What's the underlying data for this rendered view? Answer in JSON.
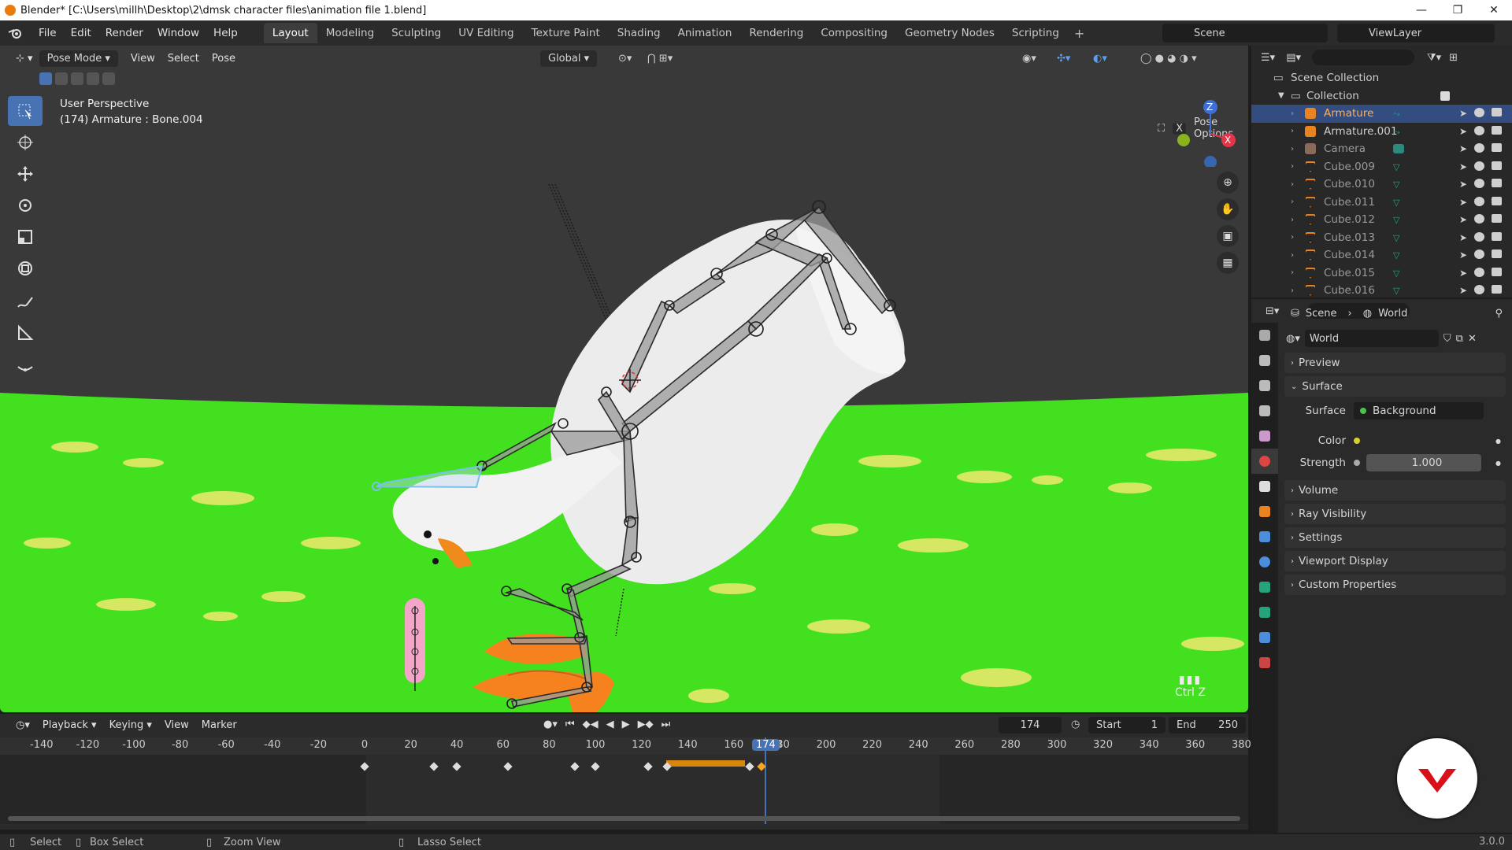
{
  "window": {
    "title": "Blender* [C:\\Users\\millh\\Desktop\\2\\dmsk character files\\animation file 1.blend]",
    "controls": [
      "—",
      "❐",
      "✕"
    ]
  },
  "menu": {
    "items": [
      "File",
      "Edit",
      "Render",
      "Window",
      "Help"
    ]
  },
  "workspaces": [
    "Layout",
    "Modeling",
    "Sculpting",
    "UV Editing",
    "Texture Paint",
    "Shading",
    "Animation",
    "Rendering",
    "Compositing",
    "Geometry Nodes",
    "Scripting"
  ],
  "active_workspace": "Layout",
  "scene_name": "Scene",
  "view_layer": "ViewLayer",
  "viewport": {
    "mode": "Pose Mode",
    "menus": [
      "View",
      "Select",
      "Pose"
    ],
    "orientation": "Global",
    "info_line1": "User Perspective",
    "info_line2": "(174) Armature : Bone.004",
    "pose_options": "Pose Options",
    "pose_x": "X",
    "ctrl_z": "Ctrl Z",
    "gizmo": {
      "z": "Z",
      "x": "X"
    }
  },
  "timeline": {
    "menus": [
      "Playback",
      "Keying",
      "View",
      "Marker"
    ],
    "current_frame": "174",
    "start_label": "Start",
    "start": "1",
    "end_label": "End",
    "end": "250",
    "ticks": [
      "-140",
      "-120",
      "-100",
      "-80",
      "-60",
      "-40",
      "-20",
      "0",
      "20",
      "40",
      "60",
      "80",
      "100",
      "120",
      "140",
      "160",
      "174",
      "180",
      "200",
      "220",
      "240",
      "260",
      "280",
      "300",
      "320",
      "340",
      "360",
      "380"
    ],
    "playhead": "174",
    "playhead_tail": "80",
    "keyframes": [
      0,
      30,
      40,
      62,
      91,
      100,
      123,
      131,
      167,
      172
    ]
  },
  "outliner": {
    "root": "Scene Collection",
    "collection": "Collection",
    "items": [
      {
        "name": "Armature",
        "selected": true
      },
      {
        "name": "Armature.001",
        "selected": false
      },
      {
        "name": "Camera",
        "selected": false
      },
      {
        "name": "Cube.009",
        "selected": false
      },
      {
        "name": "Cube.010",
        "selected": false
      },
      {
        "name": "Cube.011",
        "selected": false
      },
      {
        "name": "Cube.012",
        "selected": false
      },
      {
        "name": "Cube.013",
        "selected": false
      },
      {
        "name": "Cube.014",
        "selected": false
      },
      {
        "name": "Cube.015",
        "selected": false
      },
      {
        "name": "Cube.016",
        "selected": false
      }
    ]
  },
  "properties": {
    "breadcrumb_scene": "Scene",
    "breadcrumb_world": "World",
    "world_name": "World",
    "panels": {
      "preview": "Preview",
      "surface": "Surface",
      "volume": "Volume",
      "ray_visibility": "Ray Visibility",
      "settings": "Settings",
      "viewport_display": "Viewport Display",
      "custom_properties": "Custom Properties"
    },
    "surface_label": "Surface",
    "surface_value": "Background",
    "color_label": "Color",
    "strength_label": "Strength",
    "strength_value": "1.000"
  },
  "statusbar": {
    "select": "Select",
    "box_select": "Box Select",
    "zoom_view": "Zoom View",
    "lasso_select": "Lasso Select",
    "version": "3.0.0"
  },
  "colors": {
    "accent": "#4772b3",
    "ground": "#43e01f",
    "keyframe_range": "#d9860f",
    "fab_red": "#d8101a"
  }
}
